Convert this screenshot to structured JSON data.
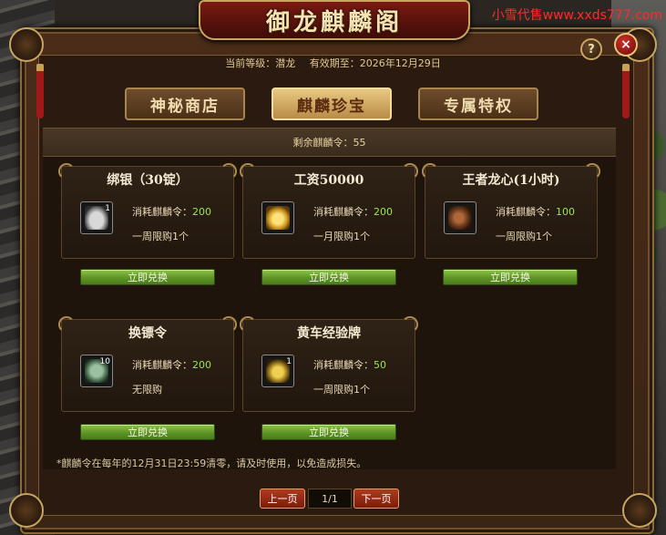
{
  "watermark": "小雪代售www.xxds777.com",
  "window": {
    "title": "御龙麒麟阁",
    "help_label": "?",
    "close_label": "×"
  },
  "info": {
    "level_label": "当前等级：",
    "level_value": "潜龙",
    "expire_label": "有效期至：",
    "expire_value": "2026年12月29日"
  },
  "tabs": [
    {
      "label": "神秘商店",
      "active": false
    },
    {
      "label": "麒麟珍宝",
      "active": true
    },
    {
      "label": "专属特权",
      "active": false
    }
  ],
  "remaining": {
    "label": "剩余麒麟令：",
    "value": "55"
  },
  "cost_label": "消耗麒麟令：",
  "items": [
    {
      "name": "绑银（30锭）",
      "icon": "silver-ingot-icon",
      "count": "1",
      "cost": "200",
      "limit": "一周限购1个",
      "button": "立即兑换"
    },
    {
      "name": "工资50000",
      "icon": "gold-treasure-icon",
      "count": "",
      "cost": "200",
      "limit": "一月限购1个",
      "button": "立即兑换"
    },
    {
      "name": "王者龙心(1小时)",
      "icon": "dragon-heart-icon",
      "count": "",
      "cost": "100",
      "limit": "一周限购1个",
      "button": "立即兑换"
    },
    {
      "name": "换镖令",
      "icon": "escort-token-icon",
      "count": "10",
      "cost": "200",
      "limit": "无限购",
      "button": "立即兑换"
    },
    {
      "name": "黄车经验牌",
      "icon": "yellow-cart-icon",
      "count": "1",
      "cost": "50",
      "limit": "一周限购1个",
      "button": "立即兑换"
    }
  ],
  "note": "*麒麟令在每年的12月31日23:59清零，请及时使用，以免造成损失。",
  "pager": {
    "prev": "上一页",
    "page": "1/1",
    "next": "下一页"
  }
}
